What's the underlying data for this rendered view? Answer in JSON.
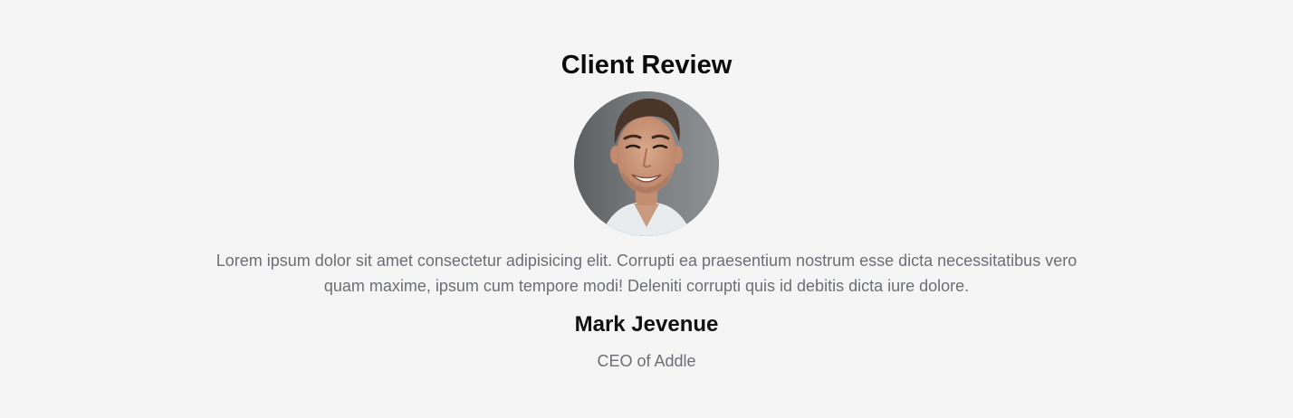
{
  "review": {
    "title": "Client Review",
    "avatar_icon": "person-portrait-photo",
    "quote": "Lorem ipsum dolor sit amet consectetur adipisicing elit. Corrupti ea praesentium nostrum esse dicta necessitatibus vero quam maxime, ipsum cum tempore modi! Deleniti corrupti quis id debitis dicta iure dolore.",
    "name": "Mark Jevenue",
    "role": "CEO of Addle"
  },
  "colors": {
    "background": "#f5f5f5",
    "heading": "#0b0b0b",
    "body_text": "#6b6f74"
  }
}
